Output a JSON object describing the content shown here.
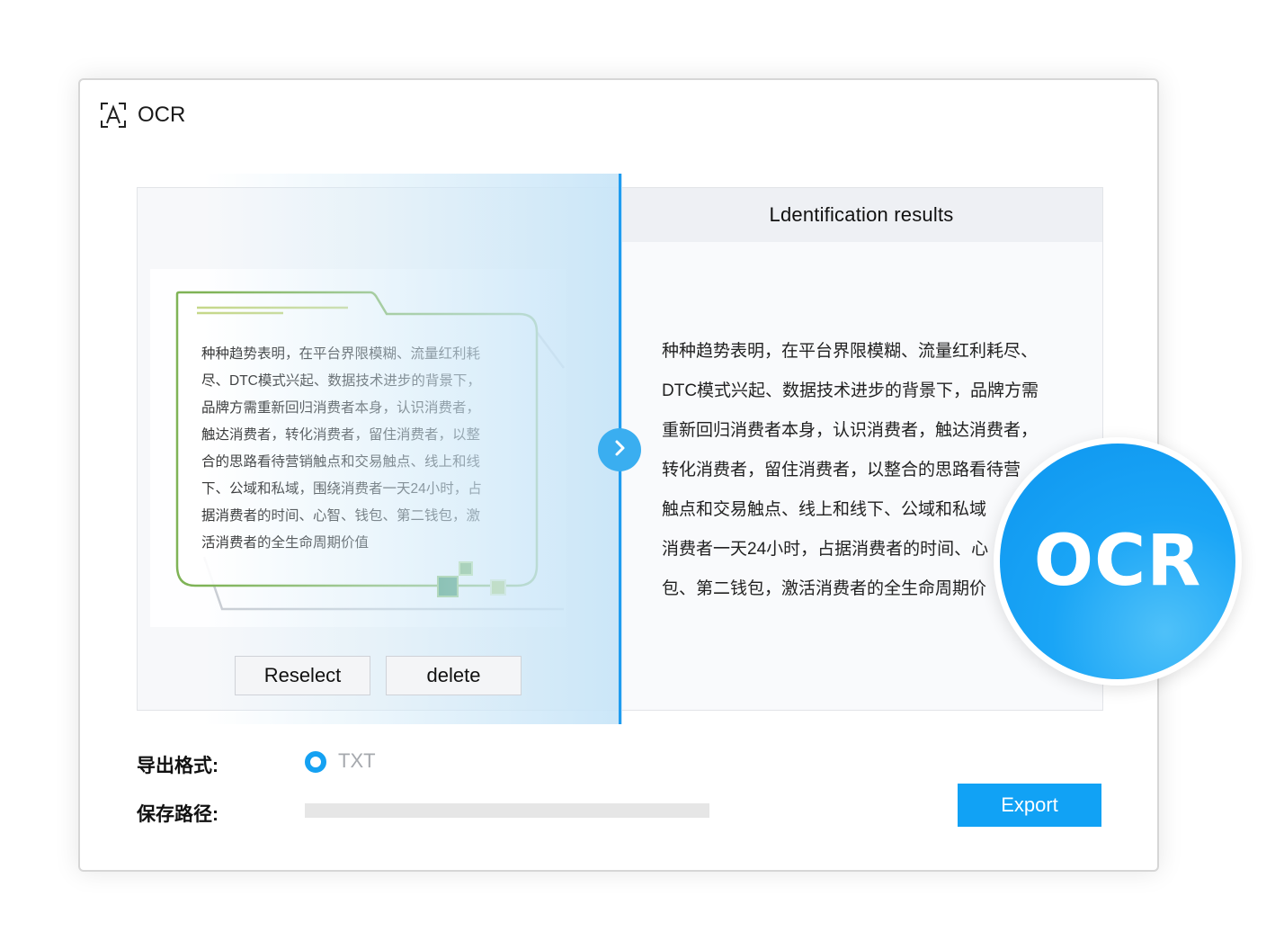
{
  "window": {
    "title": "OCR"
  },
  "preview": {
    "lines": [
      "种种趋势表明，在平台界限模糊、流量红利耗",
      "尽、DTC模式兴起、数据技术进步的背景下，",
      "品牌方需重新回归消费者本身，认识消费者，",
      "触达消费者，转化消费者，留住消费者，以整",
      "合的思路看待营销触点和交易触点、线上和线",
      "下、公域和私域，围绕消费者一天24小时，占",
      "据消费者的时间、心智、钱包、第二钱包，激",
      "活消费者的全生命周期价值"
    ],
    "reselect_label": "Reselect",
    "delete_label": "delete"
  },
  "results": {
    "header": "Ldentification results",
    "lines": [
      "种种趋势表明，在平台界限模糊、流量红利耗尽、",
      "DTC模式兴起、数据技术进步的背景下，品牌方需",
      "重新回归消费者本身，认识消费者，触达消费者，",
      "转化消费者，留住消费者，以整合的思路看待营",
      "触点和交易触点、线上和线下、公域和私域",
      "消费者一天24小时，占据消费者的时间、心",
      "包、第二钱包，激活消费者的全生命周期价"
    ]
  },
  "export": {
    "format_label": "导出格式:",
    "format_option": "TXT",
    "path_label": "保存路径:",
    "path_value": "",
    "button_label": "Export"
  },
  "badge": {
    "text": "OCR"
  },
  "colors": {
    "accent": "#11a2f5",
    "card_border": "#7fb356",
    "scan_line": "#1f9cf0"
  },
  "icons": {
    "app": "ocr-scan-icon",
    "scan_handle": "chevron-right-icon"
  }
}
